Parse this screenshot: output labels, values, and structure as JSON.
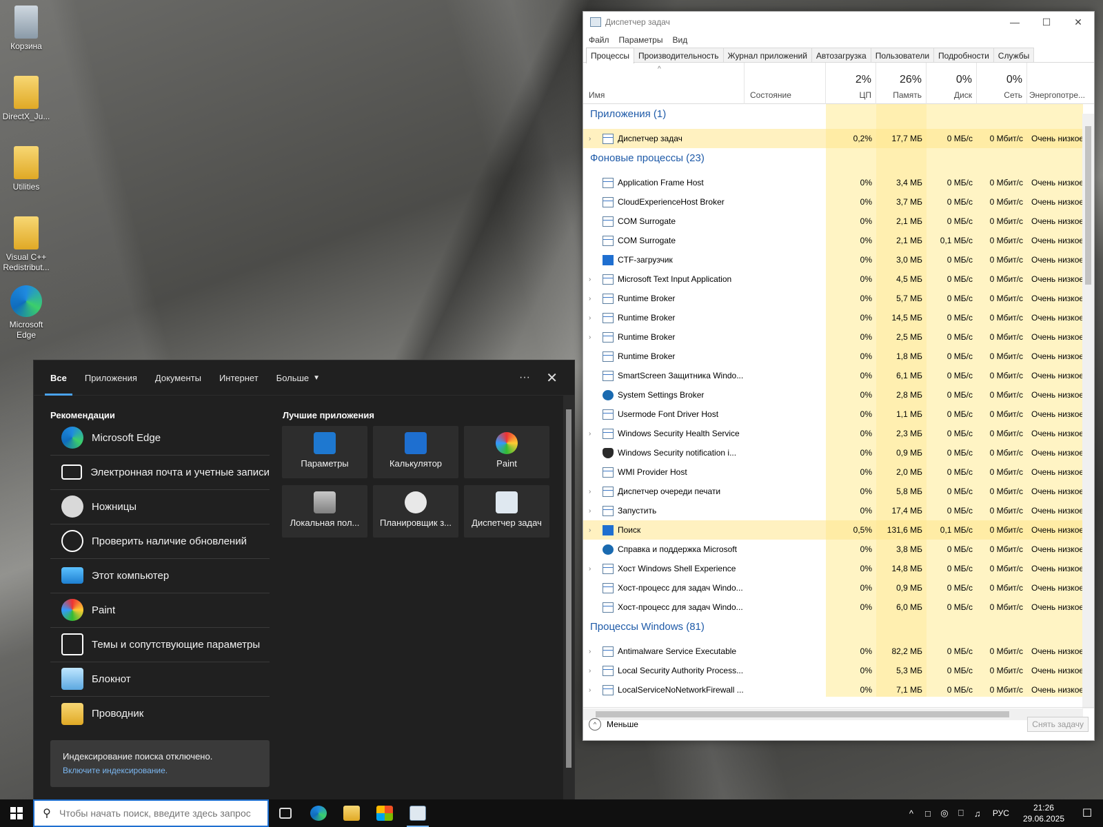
{
  "desktop": {
    "icons": [
      {
        "label": "Корзина",
        "icon": "recycle-bin-icon"
      },
      {
        "label": "DirectX_Ju...",
        "icon": "folder-icon"
      },
      {
        "label": "Utilities",
        "icon": "folder-icon"
      },
      {
        "label": "Visual C++ Redistribut...",
        "icon": "folder-icon"
      },
      {
        "label": "Microsoft Edge",
        "icon": "edge-icon"
      }
    ]
  },
  "taskmgr": {
    "title": "Диспетчер задач",
    "menu": [
      "Файл",
      "Параметры",
      "Вид"
    ],
    "tabs": [
      "Процессы",
      "Производительность",
      "Журнал приложений",
      "Автозагрузка",
      "Пользователи",
      "Подробности",
      "Службы"
    ],
    "columns": {
      "name": "Имя",
      "status": "Состояние",
      "cpu": {
        "pct": "2%",
        "label": "ЦП"
      },
      "mem": {
        "pct": "26%",
        "label": "Память"
      },
      "disk": {
        "pct": "0%",
        "label": "Диск"
      },
      "net": {
        "pct": "0%",
        "label": "Сеть"
      },
      "power": "Энергопотре..."
    },
    "groups": {
      "apps": "Приложения (1)",
      "background": "Фоновые процессы (23)",
      "windows": "Процессы Windows (81)"
    },
    "apps_rows": [
      {
        "name": "Диспетчер задач",
        "cpu": "0,2%",
        "mem": "17,7 МБ",
        "disk": "0 МБ/с",
        "net": "0 Мбит/с",
        "power": "Очень низкое"
      }
    ],
    "bg_rows": [
      {
        "name": "Application Frame Host",
        "cpu": "0%",
        "mem": "3,4 МБ",
        "disk": "0 МБ/с",
        "net": "0 Мбит/с",
        "power": "Очень низкое"
      },
      {
        "name": "CloudExperienceHost Broker",
        "cpu": "0%",
        "mem": "3,7 МБ",
        "disk": "0 МБ/с",
        "net": "0 Мбит/с",
        "power": "Очень низкое"
      },
      {
        "name": "COM Surrogate",
        "cpu": "0%",
        "mem": "2,1 МБ",
        "disk": "0 МБ/с",
        "net": "0 Мбит/с",
        "power": "Очень низкое"
      },
      {
        "name": "COM Surrogate",
        "cpu": "0%",
        "mem": "2,1 МБ",
        "disk": "0,1 МБ/с",
        "net": "0 Мбит/с",
        "power": "Очень низкое"
      },
      {
        "name": "CTF-загрузчик",
        "cpu": "0%",
        "mem": "3,0 МБ",
        "disk": "0 МБ/с",
        "net": "0 Мбит/с",
        "power": "Очень низкое"
      },
      {
        "name": "Microsoft Text Input Application",
        "cpu": "0%",
        "mem": "4,5 МБ",
        "disk": "0 МБ/с",
        "net": "0 Мбит/с",
        "power": "Очень низкое"
      },
      {
        "name": "Runtime Broker",
        "cpu": "0%",
        "mem": "5,7 МБ",
        "disk": "0 МБ/с",
        "net": "0 Мбит/с",
        "power": "Очень низкое"
      },
      {
        "name": "Runtime Broker",
        "cpu": "0%",
        "mem": "14,5 МБ",
        "disk": "0 МБ/с",
        "net": "0 Мбит/с",
        "power": "Очень низкое"
      },
      {
        "name": "Runtime Broker",
        "cpu": "0%",
        "mem": "2,5 МБ",
        "disk": "0 МБ/с",
        "net": "0 Мбит/с",
        "power": "Очень низкое"
      },
      {
        "name": "Runtime Broker",
        "cpu": "0%",
        "mem": "1,8 МБ",
        "disk": "0 МБ/с",
        "net": "0 Мбит/с",
        "power": "Очень низкое"
      },
      {
        "name": "SmartScreen Защитника Windo...",
        "cpu": "0%",
        "mem": "6,1 МБ",
        "disk": "0 МБ/с",
        "net": "0 Мбит/с",
        "power": "Очень низкое"
      },
      {
        "name": "System Settings Broker",
        "cpu": "0%",
        "mem": "2,8 МБ",
        "disk": "0 МБ/с",
        "net": "0 Мбит/с",
        "power": "Очень низкое"
      },
      {
        "name": "Usermode Font Driver Host",
        "cpu": "0%",
        "mem": "1,1 МБ",
        "disk": "0 МБ/с",
        "net": "0 Мбит/с",
        "power": "Очень низкое"
      },
      {
        "name": "Windows Security Health Service",
        "cpu": "0%",
        "mem": "2,3 МБ",
        "disk": "0 МБ/с",
        "net": "0 Мбит/с",
        "power": "Очень низкое"
      },
      {
        "name": "Windows Security notification i...",
        "cpu": "0%",
        "mem": "0,9 МБ",
        "disk": "0 МБ/с",
        "net": "0 Мбит/с",
        "power": "Очень низкое"
      },
      {
        "name": "WMI Provider Host",
        "cpu": "0%",
        "mem": "2,0 МБ",
        "disk": "0 МБ/с",
        "net": "0 Мбит/с",
        "power": "Очень низкое"
      },
      {
        "name": "Диспетчер очереди печати",
        "cpu": "0%",
        "mem": "5,8 МБ",
        "disk": "0 МБ/с",
        "net": "0 Мбит/с",
        "power": "Очень низкое"
      },
      {
        "name": "Запустить",
        "cpu": "0%",
        "mem": "17,4 МБ",
        "disk": "0 МБ/с",
        "net": "0 Мбит/с",
        "power": "Очень низкое"
      },
      {
        "name": "Поиск",
        "cpu": "0,5%",
        "mem": "131,6 МБ",
        "disk": "0,1 МБ/с",
        "net": "0 Мбит/с",
        "power": "Очень низкое"
      },
      {
        "name": "Справка и поддержка Microsoft",
        "cpu": "0%",
        "mem": "3,8 МБ",
        "disk": "0 МБ/с",
        "net": "0 Мбит/с",
        "power": "Очень низкое"
      },
      {
        "name": "Хост Windows Shell Experience",
        "cpu": "0%",
        "mem": "14,8 МБ",
        "disk": "0 МБ/с",
        "net": "0 Мбит/с",
        "power": "Очень низкое"
      },
      {
        "name": "Хост-процесс для задач Windo...",
        "cpu": "0%",
        "mem": "0,9 МБ",
        "disk": "0 МБ/с",
        "net": "0 Мбит/с",
        "power": "Очень низкое"
      },
      {
        "name": "Хост-процесс для задач Windo...",
        "cpu": "0%",
        "mem": "6,0 МБ",
        "disk": "0 МБ/с",
        "net": "0 Мбит/с",
        "power": "Очень низкое"
      }
    ],
    "win_rows": [
      {
        "name": "Antimalware Service Executable",
        "cpu": "0%",
        "mem": "82,2 МБ",
        "disk": "0 МБ/с",
        "net": "0 Мбит/с",
        "power": "Очень низкое"
      },
      {
        "name": "Local Security Authority Process...",
        "cpu": "0%",
        "mem": "5,3 МБ",
        "disk": "0 МБ/с",
        "net": "0 Мбит/с",
        "power": "Очень низкое"
      },
      {
        "name": "LocalServiceNoNetworkFirewall ...",
        "cpu": "0%",
        "mem": "7,1 МБ",
        "disk": "0 МБ/с",
        "net": "0 Мбит/с",
        "power": "Очень низкое"
      }
    ],
    "footer": {
      "less": "Меньше",
      "end_task": "Снять задачу"
    }
  },
  "search_panel": {
    "tabs": [
      "Все",
      "Приложения",
      "Документы",
      "Интернет",
      "Больше"
    ],
    "rec_heading": "Рекомендации",
    "recommendations": [
      {
        "label": "Microsoft Edge",
        "icon": "edge-icon"
      },
      {
        "label": "Электронная почта и учетные записи",
        "icon": "mail-icon"
      },
      {
        "label": "Ножницы",
        "icon": "scissors-icon"
      },
      {
        "label": "Проверить наличие обновлений",
        "icon": "refresh-icon"
      },
      {
        "label": "Этот компьютер",
        "icon": "computer-icon"
      },
      {
        "label": "Paint",
        "icon": "paint-icon"
      },
      {
        "label": "Темы и сопутствующие параметры",
        "icon": "theme-icon"
      },
      {
        "label": "Блокнот",
        "icon": "notepad-icon"
      },
      {
        "label": "Проводник",
        "icon": "explorer-icon"
      }
    ],
    "apps_heading": "Лучшие приложения",
    "top_apps": [
      {
        "label": "Параметры",
        "icon": "gear-icon"
      },
      {
        "label": "Калькулятор",
        "icon": "calculator-icon"
      },
      {
        "label": "Paint",
        "icon": "paint-icon"
      },
      {
        "label": "Локальная пол...",
        "icon": "policy-icon"
      },
      {
        "label": "Планировщик з...",
        "icon": "scheduler-icon"
      },
      {
        "label": "Диспетчер задач",
        "icon": "taskmgr-icon"
      }
    ],
    "index_notice": "Индексирование поиска отключено.",
    "index_link": "Включите индексирование."
  },
  "taskbar": {
    "search_placeholder": "Чтобы начать поиск, введите здесь запрос",
    "language": "РУС",
    "time": "21:26",
    "date": "29.06.2025"
  },
  "colors": {
    "accent": "#1e6fd0",
    "group_header": "#1e5aa8",
    "usage_light": "#fff4c4",
    "usage_medium": "#ffe79a"
  }
}
